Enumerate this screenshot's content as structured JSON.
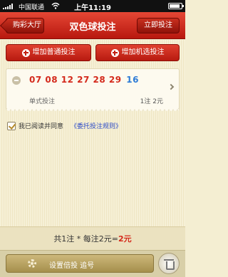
{
  "status_bar": {
    "carrier": "中国联通",
    "time": "上午11:19"
  },
  "nav": {
    "back_label": "购彩大厅",
    "title": "双色球投注",
    "bet_now_label": "立即投注"
  },
  "actions": {
    "add_normal_label": "增加普通投注",
    "add_random_label": "增加机选投注"
  },
  "ticket": {
    "red_numbers": "07 08 12 27 28 29",
    "blue_number": "16",
    "type": "单式投注",
    "summary": "1注 2元"
  },
  "agreement": {
    "text": "我已阅读并同意",
    "link": "《委托投注规则》",
    "checked": true
  },
  "totals": {
    "prefix": "共1注 * 每注2元=",
    "amount": "2元"
  },
  "footer": {
    "multiple_label": "设置倍投 追号"
  },
  "colors": {
    "brand_red": "#c42112",
    "blue_ball": "#2d7bd6",
    "background": "#f4eed2"
  }
}
